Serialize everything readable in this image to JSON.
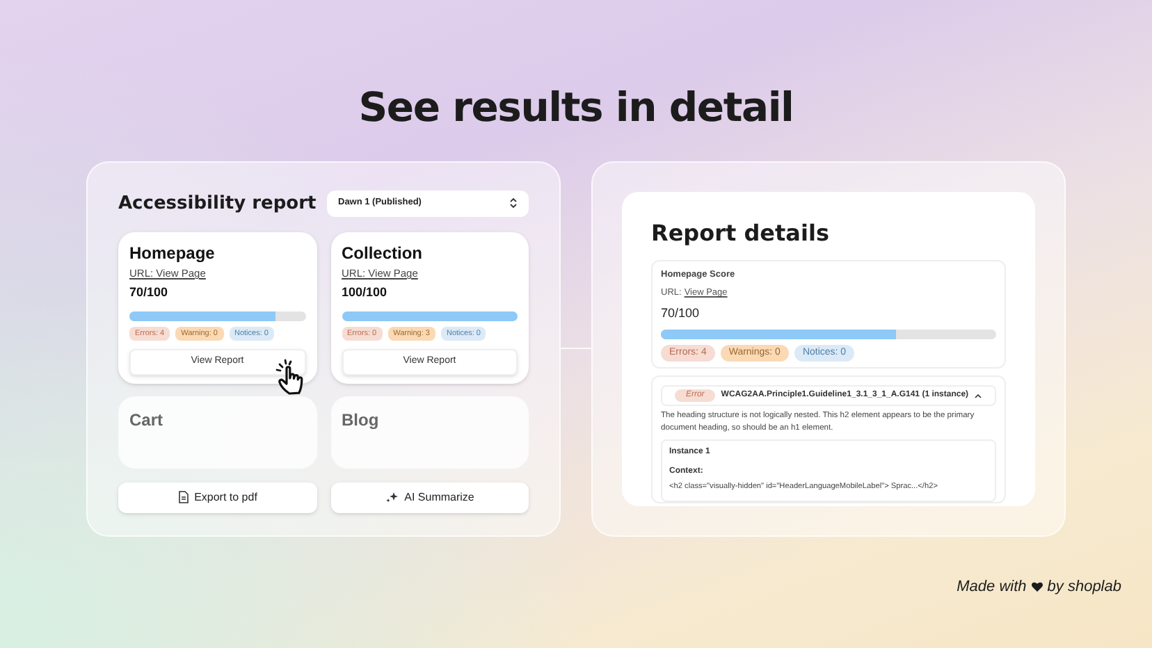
{
  "headline": "See results in detail",
  "report": {
    "title": "Accessibility report",
    "theme_select": "Dawn 1 (Published)",
    "pages": [
      {
        "name": "Homepage",
        "url_label": "URL: View Page",
        "score": "70/100",
        "level": 0.83,
        "faded": false,
        "badges": [
          {
            "kind": "error",
            "text": "Errors: 4"
          },
          {
            "kind": "warning",
            "text": "Warning: 0"
          },
          {
            "kind": "notice",
            "text": "Notices: 0"
          }
        ],
        "button": "View Report",
        "pointer": true
      },
      {
        "name": "Collection",
        "url_label": "URL: View Page",
        "score": "100/100",
        "level": 1,
        "faded": false,
        "badges": [
          {
            "kind": "error",
            "text": "Errors: 0"
          },
          {
            "kind": "warning",
            "text": "Warning: 3"
          },
          {
            "kind": "notice",
            "text": "Notices: 0"
          }
        ],
        "button": "View Report",
        "pointer": false
      },
      {
        "name": "Cart",
        "faded": true
      },
      {
        "name": "Blog",
        "faded": true
      }
    ],
    "actions": [
      {
        "kind": "export",
        "label": "Export to pdf"
      },
      {
        "kind": "ai",
        "label": "AI Summarize"
      }
    ]
  },
  "details": {
    "title": "Report details",
    "score_title": "Homepage Score",
    "url_prefix": "URL:",
    "url_link": "View Page",
    "score": "70/100",
    "level": 0.7,
    "badges": [
      {
        "kind": "error",
        "text": "Errors: 4"
      },
      {
        "kind": "warning",
        "text": "Warnings: 0"
      },
      {
        "kind": "notice",
        "text": "Notices: 0"
      }
    ],
    "issue": {
      "tag": "Error",
      "code": "WCAG2AA.Principle1.Guideline1_3.1_3_1_A.G141 (1 instance)",
      "expanded": true,
      "description": "The heading structure is not logically nested. This h2 element appears to be the primary document heading, so should be an h1 element.",
      "instance_title": "Instance 1",
      "context_label": "Context:",
      "context": "<h2 class=\"visually-hidden\" id=\"HeaderLanguageMobileLabel\"> Sprac...</h2>"
    }
  },
  "footer": {
    "made_with": "Made with",
    "by": "by shoplab"
  }
}
